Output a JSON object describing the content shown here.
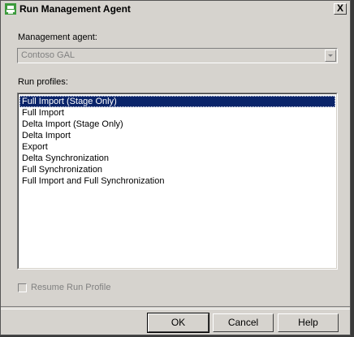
{
  "window": {
    "title": "Run Management Agent",
    "close_glyph": "X"
  },
  "management_agent": {
    "label": "Management agent:",
    "value": "Contoso GAL"
  },
  "run_profiles": {
    "label": "Run profiles:",
    "items": [
      "Full Import (Stage Only)",
      "Full Import",
      "Delta Import (Stage Only)",
      "Delta Import",
      "Export",
      "Delta Synchronization",
      "Full Synchronization",
      "Full Import and Full Synchronization"
    ],
    "selected_index": 0
  },
  "resume": {
    "label": "Resume Run Profile",
    "checked": false
  },
  "buttons": {
    "ok": "OK",
    "cancel": "Cancel",
    "help": "Help"
  },
  "colors": {
    "selection": "#0a246a",
    "dialog_face": "#d6d3ce",
    "app_icon": "#3c9a3c"
  },
  "icons": {
    "app": "green-agent-icon",
    "close": "close-icon",
    "dropdown": "chevron-down-icon"
  }
}
